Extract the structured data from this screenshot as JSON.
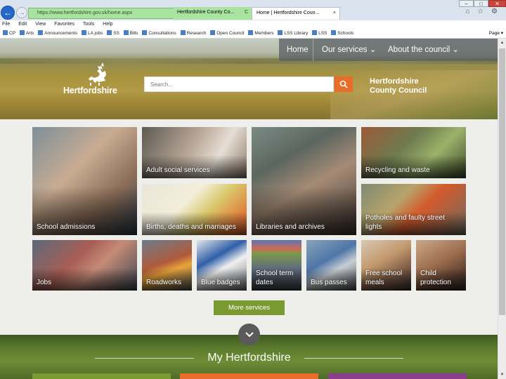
{
  "browser": {
    "address": "https://www.hertfordshire.gov.uk/home.aspx",
    "address_icons": "⌕ ▾ 🔒 ↻",
    "tabs": [
      {
        "label": "Hertfordshire County Co...",
        "close": "C"
      },
      {
        "label": "Home | Hertfordshire Coun...",
        "close": "×"
      }
    ],
    "window_controls": {
      "minimize": "–",
      "maximize": "□",
      "close": "✕"
    },
    "toolbar_icons": "⌂ ☆ ⚙",
    "menu": [
      "File",
      "Edit",
      "View",
      "Favorites",
      "Tools",
      "Help"
    ],
    "favorites": [
      "CP",
      "Arts",
      "Announcements",
      "LA jobs",
      "SS",
      "Bills",
      "Consultations",
      "Research",
      "Open Council",
      "Members",
      "LSS Library",
      "LSS",
      "Schools"
    ],
    "fav_tools": [
      "Page ▾"
    ]
  },
  "nav": {
    "home": "Home",
    "services": "Our services ⌄",
    "council": "About the council ⌄"
  },
  "logo": {
    "text": "Hertfordshire"
  },
  "search": {
    "placeholder": "Search..."
  },
  "council_name": {
    "line1": "Hertfordshire",
    "line2": "County Council"
  },
  "tiles": [
    {
      "label": "School admissions"
    },
    {
      "label": "Adult social services"
    },
    {
      "label": "Births, deaths and marriages"
    },
    {
      "label": "Libraries and archives"
    },
    {
      "label": "Recycling and waste"
    },
    {
      "label": "Potholes and faulty street lights"
    },
    {
      "label": "Jobs"
    },
    {
      "label": "Roadworks"
    },
    {
      "label": "Blue badges"
    },
    {
      "label": "School term dates"
    },
    {
      "label": "Bus passes"
    },
    {
      "label": "Free school meals"
    },
    {
      "label": "Child protection"
    }
  ],
  "more_services": "More services",
  "my_section": {
    "title": "My Hertfordshire"
  },
  "colors": {
    "orange": "#e86c2a",
    "green": "#7a9a32",
    "purple": "#8a3f8a"
  }
}
